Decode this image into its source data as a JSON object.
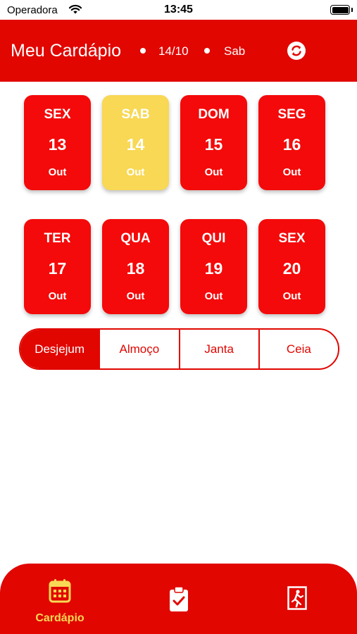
{
  "status_bar": {
    "carrier": "Operadora",
    "time": "13:45"
  },
  "header": {
    "title": "Meu Cardápio",
    "date": "14/10",
    "weekday": "Sab",
    "refresh_icon": "refresh-icon"
  },
  "days": [
    {
      "weekday": "SEX",
      "day": "13",
      "month": "Out",
      "selected": false
    },
    {
      "weekday": "SAB",
      "day": "14",
      "month": "Out",
      "selected": true
    },
    {
      "weekday": "DOM",
      "day": "15",
      "month": "Out",
      "selected": false
    },
    {
      "weekday": "SEG",
      "day": "16",
      "month": "Out",
      "selected": false
    },
    {
      "weekday": "TER",
      "day": "17",
      "month": "Out",
      "selected": false
    },
    {
      "weekday": "QUA",
      "day": "18",
      "month": "Out",
      "selected": false
    },
    {
      "weekday": "QUI",
      "day": "19",
      "month": "Out",
      "selected": false
    },
    {
      "weekday": "SEX",
      "day": "20",
      "month": "Out",
      "selected": false
    }
  ],
  "meals": {
    "items": [
      "Desjejum",
      "Almoço",
      "Janta",
      "Ceia"
    ],
    "selected": "Desjejum"
  },
  "tabbar": {
    "tabs": [
      {
        "label": "Cardápio",
        "icon": "calendar-icon",
        "active": true
      },
      {
        "label": "",
        "icon": "clipboard-check-icon",
        "active": false
      },
      {
        "label": "",
        "icon": "exit-icon",
        "active": false
      }
    ]
  },
  "colors": {
    "primary": "#E10600",
    "card": "#F40A0A",
    "selected": "#F8D854",
    "text_on_primary": "#FFFFFF"
  }
}
